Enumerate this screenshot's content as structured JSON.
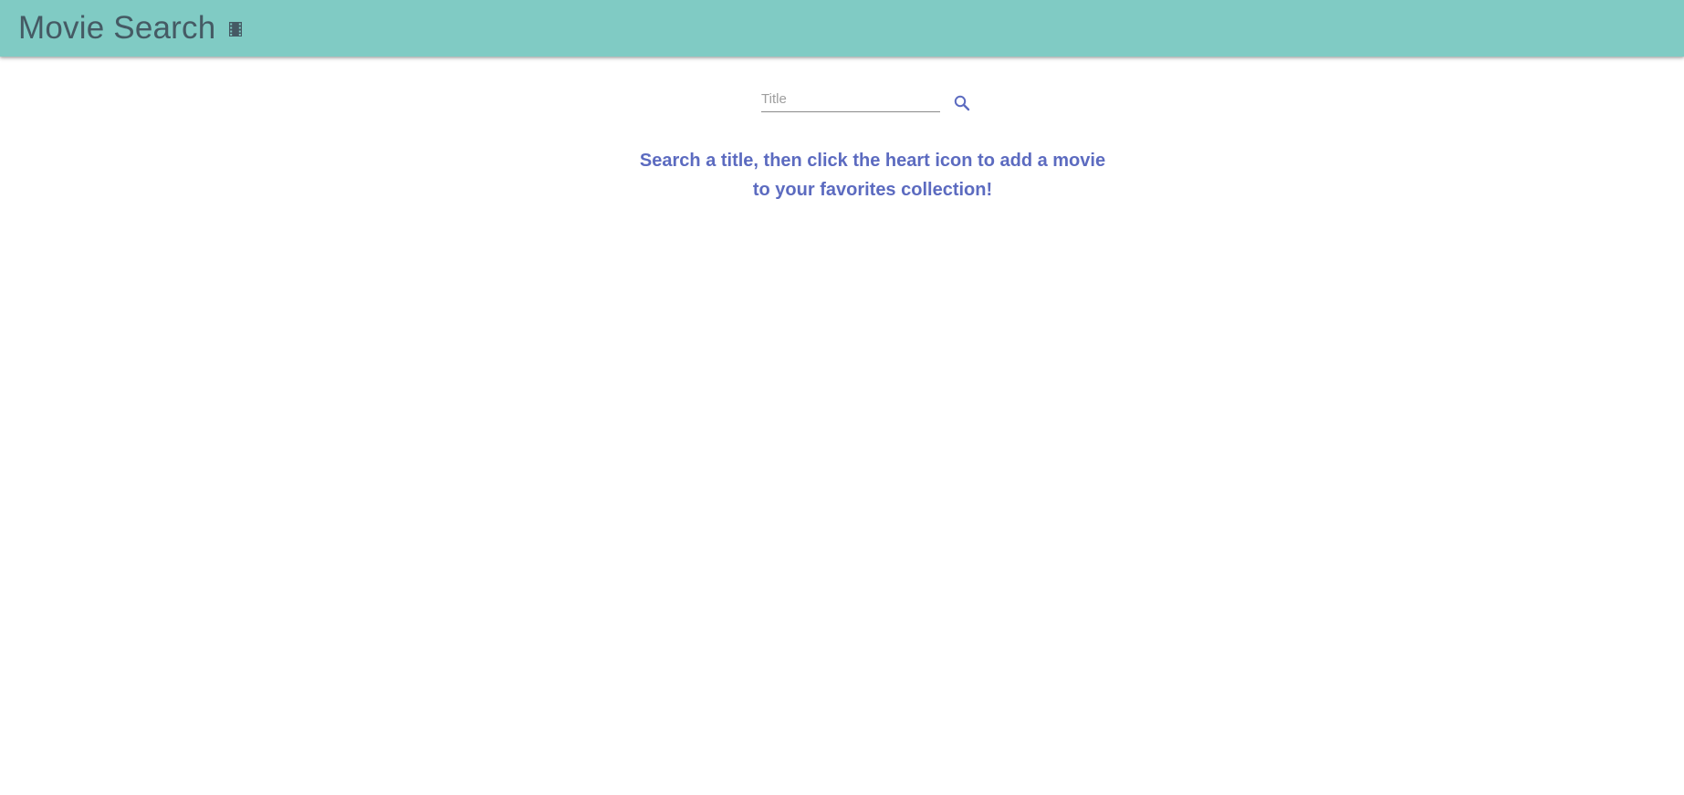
{
  "header": {
    "title": "Movie Search",
    "icon": "film-icon",
    "background_color": "#80cbc4",
    "text_color": "#455a64"
  },
  "search": {
    "placeholder": "Title",
    "value": "",
    "button_icon": "search-icon",
    "accent_color": "#5c6bc0"
  },
  "hint": {
    "line1": "Search a title, then click the heart icon to add a movie",
    "line2": "to your favorites collection!",
    "color": "#5c6bc0"
  }
}
